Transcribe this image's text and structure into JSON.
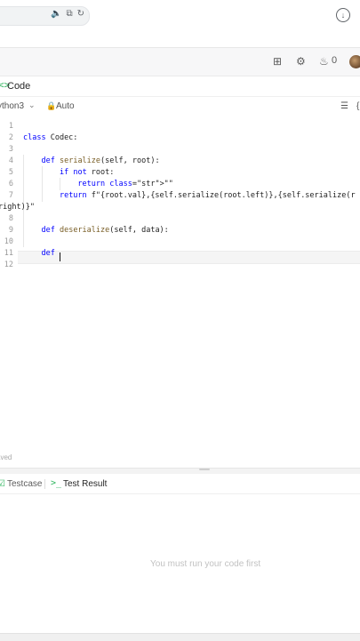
{
  "browser": {
    "addr_icons": [
      "speaker-icon",
      "translate-icon",
      "refresh-icon"
    ],
    "download_icon": "download-icon"
  },
  "nav": {
    "icons": [
      "layout-icon",
      "settings-icon",
      "fire-icon"
    ],
    "streak_count": "0"
  },
  "code_panel": {
    "title": "Code",
    "language": "ython3",
    "mode": "Auto"
  },
  "editor": {
    "line_numbers": [
      "1",
      "2",
      "3",
      "4",
      "5",
      "6",
      "7",
      "8",
      "9",
      "10",
      "11",
      "12"
    ],
    "lines": [
      "",
      "class Codec:",
      "",
      "    def serialize(self, root):",
      "        if not root:",
      "            return \"\"",
      "        return f\"{root.val},{self.serialize(root.left)},{self.serialize(r",
      "right)}\"",
      "",
      "    def deserialize(self, data):",
      "",
      "    def ",
      ""
    ]
  },
  "status": {
    "saved": "aved"
  },
  "bottom_panel": {
    "tab_testcase": "Testcase",
    "tab_result": "Test Result",
    "result_message": "You must run your code first"
  },
  "colors": {
    "accent_green": "#2db55d",
    "keyword": "#0000ff",
    "function": "#795e26",
    "string": "#a31515"
  }
}
